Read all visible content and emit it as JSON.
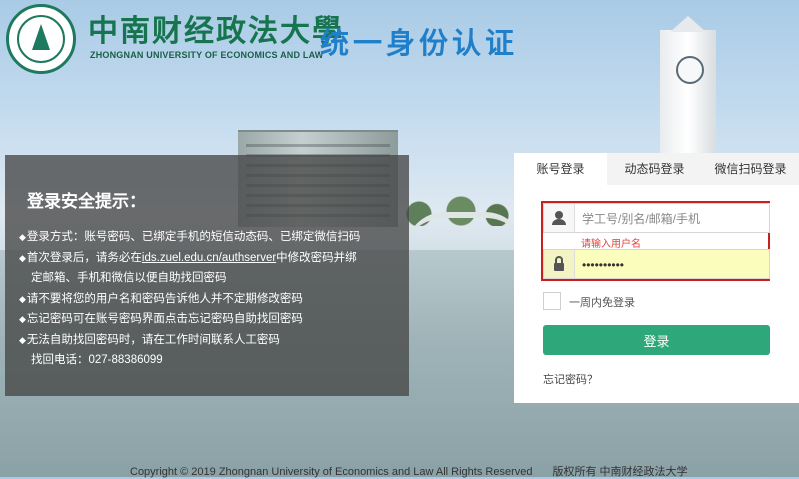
{
  "header": {
    "school_name_cn": "中南财经政法大學",
    "school_name_en": "ZHONGNAN UNIVERSITY OF ECONOMICS AND LAW",
    "system_title": "统一身份认证"
  },
  "tips": {
    "title": "登录安全提示：",
    "items": [
      "登录方式：账号密码、已绑定手机的短信动态码、已绑定微信扫码",
      "首次登录后，请务必在",
      "ids.zuel.edu.cn/authserver",
      "中修改密码并绑",
      "定邮箱、手机和微信以便自助找回密码",
      "请不要将您的用户名和密码告诉他人并不定期修改密码",
      "忘记密码可在账号密码界面点击忘记密码自助找回密码",
      "无法自助找回密码时，请在工作时间联系人工密码",
      "找回电话：027-88386099"
    ]
  },
  "login": {
    "tabs": [
      "账号登录",
      "动态码登录",
      "微信扫码登录"
    ],
    "active_tab": "账号登录",
    "username_placeholder": "学工号/别名/邮箱/手机",
    "username_value": "",
    "username_error": "请输入用户名",
    "password_value": "••••••••••",
    "remember_label": "一周内免登录",
    "remember_checked": false,
    "submit_label": "登录",
    "forgot_label": "忘记密码？"
  },
  "footer": {
    "copyright": "Copyright © 2019 Zhongnan University of Economics and Law  All Rights Reserved",
    "rights": "版权所有 中南财经政法大学"
  },
  "colors": {
    "brand_green": "#1e7a5f",
    "title_blue": "#1f7fc9",
    "button_green": "#2ea77b",
    "error_red": "#e0443c"
  }
}
